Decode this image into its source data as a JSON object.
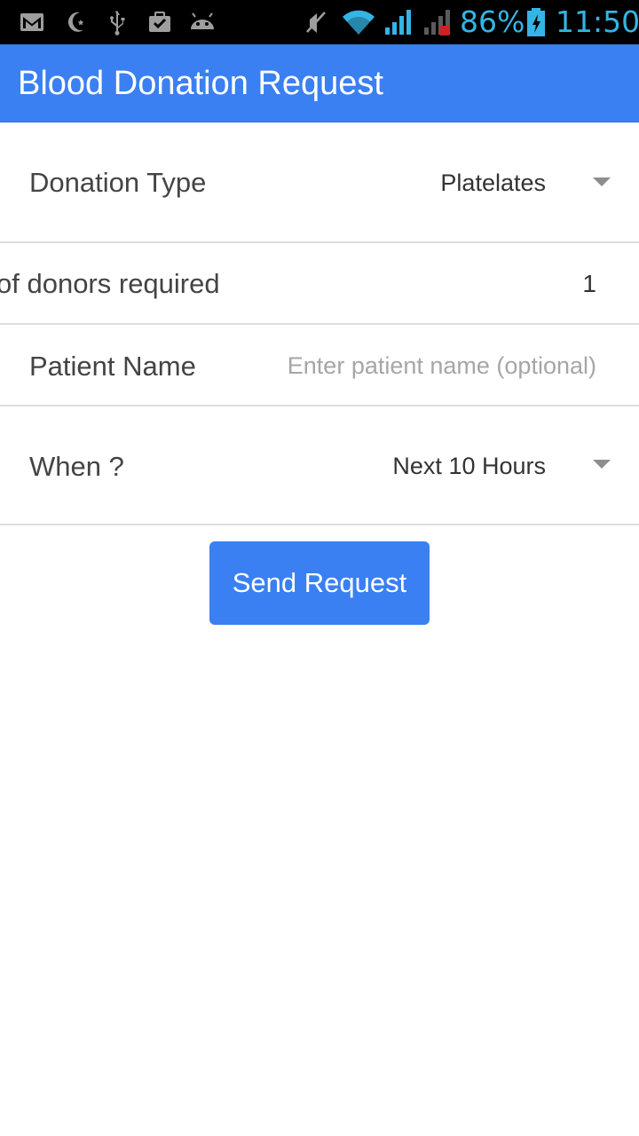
{
  "status_bar": {
    "icons": [
      "gmail-icon",
      "moon-icon",
      "usb-icon",
      "briefcase-icon",
      "android-icon",
      "mute-icon",
      "wifi-icon",
      "signal-icon",
      "signal-roaming-icon",
      "battery-charging-icon"
    ],
    "battery_percent": "86%",
    "time": "11:50",
    "accent_color": "#33b5e5"
  },
  "app_bar": {
    "title": "Blood Donation Request",
    "color": "#3a80f2"
  },
  "form": {
    "donation_type": {
      "label": "Donation Type",
      "value": "Platelates"
    },
    "donors_required": {
      "label": "No. of donors required",
      "visible_label": "of donors required",
      "value": "1"
    },
    "patient_name": {
      "label": "Patient Name",
      "placeholder": "Enter patient name (optional)",
      "value": ""
    },
    "when": {
      "label": "When ?",
      "value": "Next 10 Hours"
    }
  },
  "actions": {
    "send_label": "Send Request"
  }
}
